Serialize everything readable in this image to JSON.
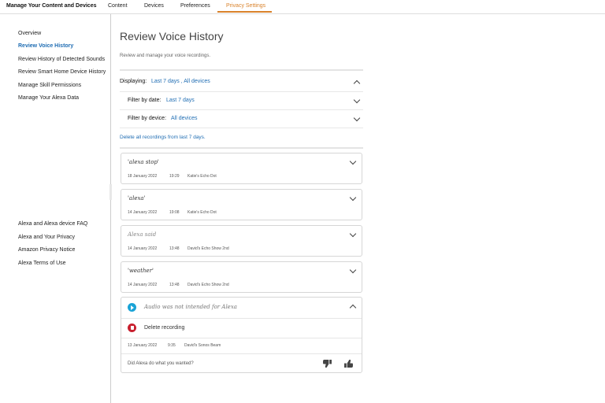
{
  "nav": {
    "brand": "Manage Your Content and Devices",
    "tabs": [
      {
        "label": "Content"
      },
      {
        "label": "Devices"
      },
      {
        "label": "Preferences"
      },
      {
        "label": "Privacy Settings",
        "active": true
      }
    ]
  },
  "sidebar": {
    "items": [
      {
        "label": "Overview"
      },
      {
        "label": "Review Voice History",
        "active": true
      },
      {
        "label": "Review History of Detected Sounds"
      },
      {
        "label": "Review Smart Home Device History"
      },
      {
        "label": "Manage Skill Permissions"
      },
      {
        "label": "Manage Your Alexa Data"
      }
    ],
    "links": [
      {
        "label": "Alexa and Alexa device FAQ"
      },
      {
        "label": "Alexa and Your Privacy"
      },
      {
        "label": "Amazon Privacy Notice"
      },
      {
        "label": "Alexa Terms of Use"
      }
    ]
  },
  "main": {
    "title": "Review Voice History",
    "subtitle": "Review and manage your voice recordings.",
    "displaying_label": "Displaying:",
    "displaying_value": "Last 7 days , All devices",
    "filter_date_label": "Filter by date:",
    "filter_date_value": "Last 7 days",
    "filter_device_label": "Filter by device:",
    "filter_device_value": "All devices",
    "delete_all": "Delete all recordings from last 7 days.",
    "recordings": [
      {
        "utterance": "'alexa stop'",
        "date": "18 January 2022",
        "time": "19:29",
        "device": "Katie's Echo Dot"
      },
      {
        "utterance": "'alexa'",
        "date": "14 January 2022",
        "time": "19:08",
        "device": "Katie's Echo Dot"
      },
      {
        "utterance": "Alexa said",
        "date": "14 January 2022",
        "time": "13:48",
        "device": "David's Echo Show 2nd"
      },
      {
        "utterance": "'weather'",
        "date": "14 January 2022",
        "time": "13:48",
        "device": "David's Echo Show 2nd"
      }
    ],
    "expanded": {
      "utterance": "Audio was not intended for Alexa",
      "delete_label": "Delete recording",
      "date": "13 January 2022",
      "time": "9:35",
      "device": "David's Sonos Beam",
      "feedback_question": "Did Alexa do what you wanted?"
    }
  },
  "colors": {
    "accent": "#d9822b",
    "link": "#1f6db3",
    "play": "#1aa3d6",
    "delete": "#c8202f"
  }
}
